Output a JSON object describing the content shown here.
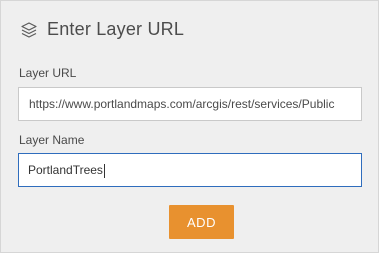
{
  "dialog": {
    "title": "Enter Layer URL",
    "icon": "layers-icon"
  },
  "fields": {
    "url": {
      "label": "Layer URL",
      "value": "https://www.portlandmaps.com/arcgis/rest/services/Public"
    },
    "name": {
      "label": "Layer Name",
      "value": "PortlandTrees"
    }
  },
  "actions": {
    "add_label": "ADD"
  },
  "colors": {
    "accent_button": "#e8912f",
    "focus_border": "#2f6dbd",
    "panel_bg": "#efefef"
  }
}
